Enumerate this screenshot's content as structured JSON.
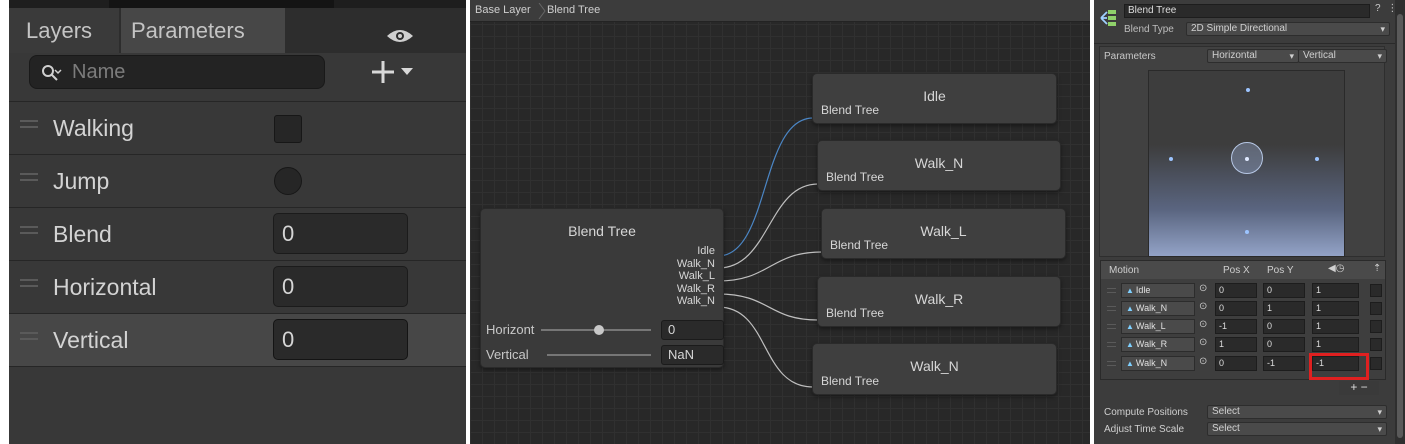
{
  "left": {
    "tabs": {
      "layers": "Layers",
      "parameters": "Parameters"
    },
    "eye_icon": "eye-icon",
    "search": {
      "placeholder": "Name",
      "icon": "search-icon"
    },
    "add_icon": "plus-dropdown-icon",
    "parameters": [
      {
        "name": "Walking",
        "type": "bool"
      },
      {
        "name": "Jump",
        "type": "trigger"
      },
      {
        "name": "Blend",
        "type": "float",
        "value": "0"
      },
      {
        "name": "Horizontal",
        "type": "float",
        "value": "0"
      },
      {
        "name": "Vertical",
        "type": "float",
        "value": "0",
        "selected": true
      }
    ]
  },
  "graph": {
    "breadcrumbs": [
      "Base Layer",
      "Blend Tree"
    ],
    "blend_tree_node": {
      "title": "Blend Tree",
      "outputs": [
        "Idle",
        "Walk_N",
        "Walk_L",
        "Walk_R",
        "Walk_N"
      ],
      "sliders": [
        {
          "label": "Horizont",
          "value": "0"
        },
        {
          "label": "Vertical",
          "value": "NaN"
        }
      ]
    },
    "motion_nodes": [
      {
        "title": "Idle",
        "sub": "Blend Tree"
      },
      {
        "title": "Walk_N",
        "sub": "Blend Tree"
      },
      {
        "title": "Walk_L",
        "sub": "Blend Tree"
      },
      {
        "title": "Walk_R",
        "sub": "Blend Tree"
      },
      {
        "title": "Walk_N",
        "sub": "Blend Tree"
      }
    ]
  },
  "inspector": {
    "name": "Blend Tree",
    "blend_type_label": "Blend Type",
    "blend_type": "2D Simple Directional",
    "parameters_label": "Parameters",
    "param_x": "Horizontal",
    "param_y": "Vertical",
    "motion_headers": {
      "motion": "Motion",
      "pos_x": "Pos X",
      "pos_y": "Pos Y",
      "speed_icon": "clock-icon",
      "mirror_icon": "mirror-icon"
    },
    "motions": [
      {
        "clip": "Idle",
        "pos_x": "0",
        "pos_y": "0",
        "speed": "1"
      },
      {
        "clip": "Walk_N",
        "pos_x": "0",
        "pos_y": "1",
        "speed": "1"
      },
      {
        "clip": "Walk_L",
        "pos_x": "-1",
        "pos_y": "0",
        "speed": "1"
      },
      {
        "clip": "Walk_R",
        "pos_x": "1",
        "pos_y": "0",
        "speed": "1"
      },
      {
        "clip": "Walk_N",
        "pos_x": "0",
        "pos_y": "-1",
        "speed": "-1"
      }
    ],
    "plus_minus": "+  −",
    "compute_positions_label": "Compute Positions",
    "compute_positions": "Select",
    "adjust_time_scale_label": "Adjust Time Scale",
    "adjust_time_scale": "Select",
    "highlight_color": "#e02020"
  }
}
